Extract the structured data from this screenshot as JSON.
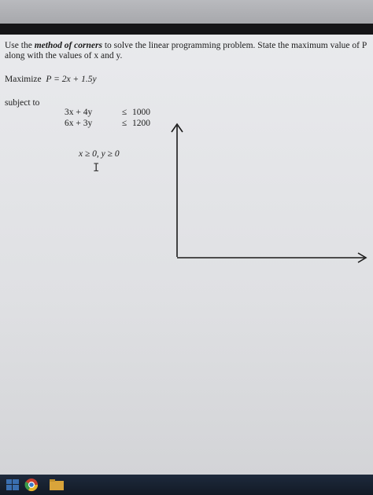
{
  "question": {
    "prefix": "Use the ",
    "method": "method of corners",
    "suffix": " to solve the linear programming problem. State the maximum value of P along with the values of x and y."
  },
  "objective": {
    "label": "Maximize",
    "expression": "P = 2x + 1.5y"
  },
  "subject_to_label": "subject to",
  "constraints": [
    {
      "lhs": "3x + 4y",
      "op": "≤",
      "rhs": "1000"
    },
    {
      "lhs": "6x + 3y",
      "op": "≤",
      "rhs": "1200"
    }
  ],
  "nonnegativity": "x ≥ 0,  y ≥ 0",
  "icons": {
    "text_cursor": "text-cursor-icon",
    "graph_axes": "graph-axes",
    "taskbar": [
      "windows-start-icon",
      "chrome-icon",
      "folder-icon"
    ]
  },
  "colors": {
    "ink": "#1c1c1c",
    "page": "#e6e7ea",
    "taskbar": "#18212f"
  }
}
